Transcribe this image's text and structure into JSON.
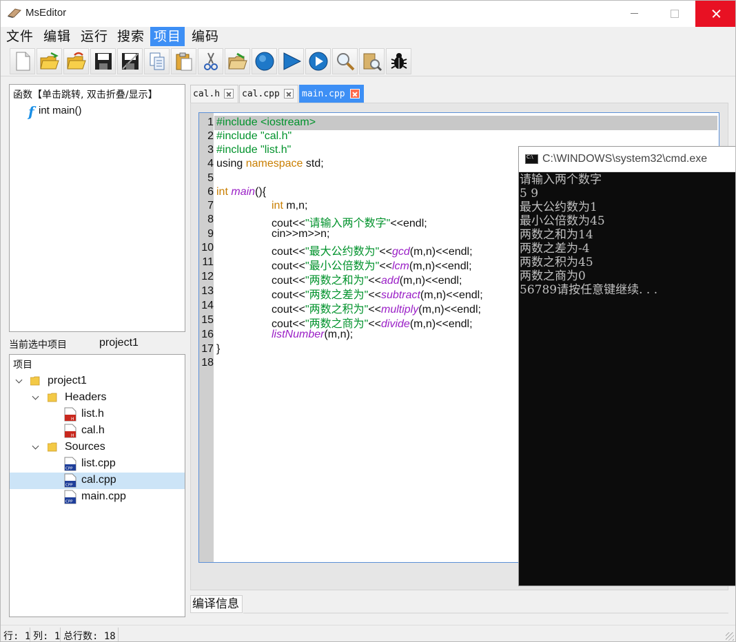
{
  "window": {
    "title": "MsEditor"
  },
  "menu": [
    "文件",
    "编辑",
    "运行",
    "搜索",
    "项目",
    "编码"
  ],
  "menu_active_index": 4,
  "toolbar": [
    "new-file-icon",
    "open-file-icon",
    "open-folder-icon",
    "save-icon",
    "save-all-icon",
    "copy-icon",
    "paste-icon",
    "cut-icon",
    "open-project-icon",
    "stop-icon",
    "run-icon",
    "compile-run-icon",
    "find-icon",
    "find-in-files-icon",
    "debug-icon"
  ],
  "function_panel": {
    "header": "函数【单击跳转, 双击折叠/显示】",
    "icon_glyph": "f",
    "items": [
      "int main()"
    ]
  },
  "current_project": {
    "label": "当前选中项目",
    "value": "project1"
  },
  "project_tree": {
    "header": "项目",
    "root": "project1",
    "headers_folder": "Headers",
    "headers": [
      "list.h",
      "cal.h"
    ],
    "sources_folder": "Sources",
    "sources": [
      "list.cpp",
      "cal.cpp",
      "main.cpp"
    ],
    "selected": "cal.cpp"
  },
  "tabs": [
    {
      "label": "cal.h",
      "active": false
    },
    {
      "label": "cal.cpp",
      "active": false
    },
    {
      "label": "main.cpp",
      "active": true
    }
  ],
  "editor": {
    "line_numbers": [
      "1",
      "2",
      "3",
      "4",
      "5",
      "6",
      "7",
      "8",
      "9",
      "10",
      "11",
      "12",
      "13",
      "14",
      "15",
      "16",
      "17",
      "18"
    ],
    "current_line": 1
  },
  "console": {
    "title": "C:\\WINDOWS\\system32\\cmd.exe",
    "lines": [
      "请输入两个数字",
      "5 9",
      "最大公约数为1",
      "最小公倍数为45",
      "两数之和为14",
      "两数之差为-4",
      "两数之积为45",
      "两数之商为0",
      "56789请按任意键继续. . ."
    ]
  },
  "compile_info": {
    "label": "编译信息"
  },
  "status": {
    "row": "行: 1",
    "col": "列: 1",
    "total": "总行数: 18"
  },
  "colors": {
    "accent": "#3d8ff5",
    "keyword": "#c97e00",
    "string": "#00922b",
    "function": "#9a1fc6"
  }
}
